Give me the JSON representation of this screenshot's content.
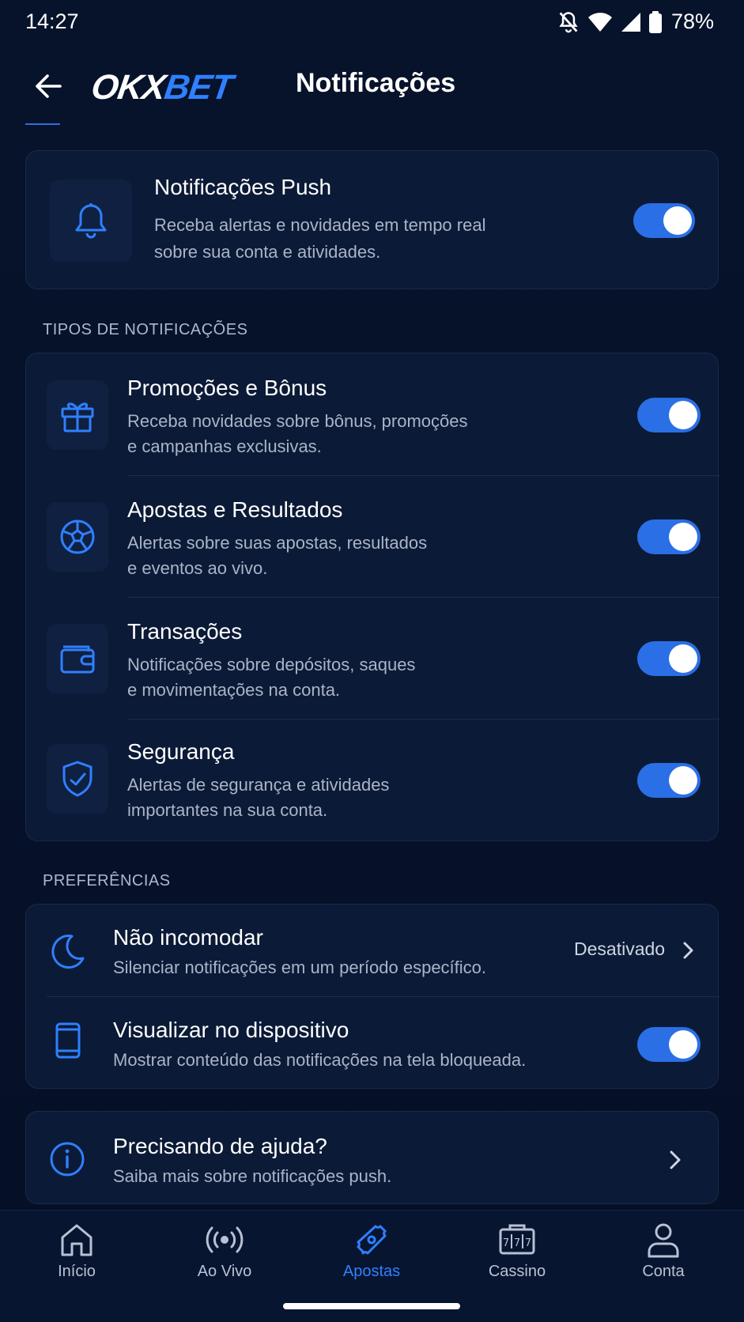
{
  "status_bar": {
    "time": "14:27",
    "battery": "78%"
  },
  "header": {
    "logo_okx": "OKX",
    "logo_bet": "BET",
    "title": "Notificações"
  },
  "push": {
    "title": "Notificações Push",
    "desc_line1": "Receba alertas e novidades em tempo real",
    "desc_line2": "sobre sua conta e atividades.",
    "enabled": true
  },
  "types_section": {
    "label": "TIPOS DE NOTIFICAÇÕES",
    "items": [
      {
        "title": "Promoções e Bônus",
        "desc_line1": "Receba novidades sobre bônus, promoções",
        "desc_line2": "e campanhas exclusivas.",
        "icon": "gift-icon",
        "enabled": true
      },
      {
        "title": "Apostas e Resultados",
        "desc_line1": "Alertas sobre suas apostas, resultados",
        "desc_line2": "e eventos ao vivo.",
        "icon": "soccer-ball-icon",
        "enabled": true
      },
      {
        "title": "Transações",
        "desc_line1": "Notificações sobre depósitos, saques",
        "desc_line2": "e movimentações na conta.",
        "icon": "wallet-icon",
        "enabled": true
      },
      {
        "title": "Segurança",
        "desc_line1": "Alertas de segurança e atividades",
        "desc_line2": "importantes na sua conta.",
        "icon": "shield-check-icon",
        "enabled": true
      }
    ]
  },
  "preferences_section": {
    "label": "PREFERÊNCIAS",
    "dnd": {
      "title": "Não incomodar",
      "desc": "Silenciar notificações em um período específico.",
      "value": "Desativado"
    },
    "device": {
      "title": "Visualizar no dispositivo",
      "desc": "Mostrar conteúdo das notificações na tela bloqueada.",
      "enabled": true
    }
  },
  "help": {
    "title": "Precisando de ajuda?",
    "desc": "Saiba mais sobre notificações push."
  },
  "bottom_nav": {
    "items": [
      {
        "label": "Início",
        "icon": "home-icon"
      },
      {
        "label": "Ao Vivo",
        "icon": "live-broadcast-icon"
      },
      {
        "label": "Apostas",
        "icon": "ticket-icon",
        "active": true
      },
      {
        "label": "Cassino",
        "icon": "slot-machine-icon"
      },
      {
        "label": "Conta",
        "icon": "user-icon"
      }
    ]
  },
  "colors": {
    "accent": "#2f80ff",
    "background": "#07122b",
    "card": "#0b1a36",
    "toggle_on": "#2b6fe6"
  }
}
